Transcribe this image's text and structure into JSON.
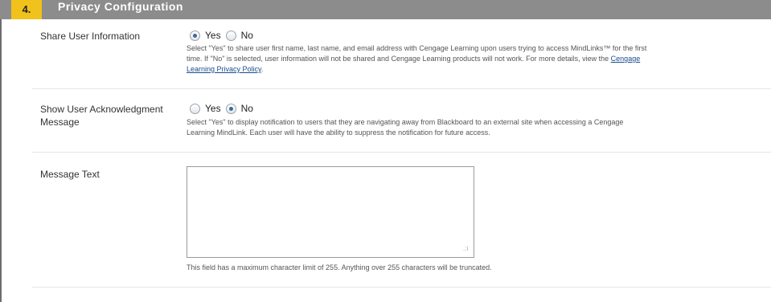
{
  "section": {
    "number": "4.",
    "title": "Privacy Configuration"
  },
  "share_user_info": {
    "label": "Share User Information",
    "options": [
      "Yes",
      "No"
    ],
    "selected": "Yes",
    "help_line1": "Select \"Yes\" to share user first name, last name, and email address with Cengage Learning upon users trying to access MindLinks™ for the first",
    "help_line2": "time. If \"No\" is selected, user information will not be shared and Cengage Learning products will not work. For more details, view the",
    "help_link_part1": "Cengage",
    "help_link_part2": "Learning Privacy Policy",
    "help_end": "."
  },
  "show_ack": {
    "label_line1": "Show User Acknowledgment",
    "label_line2": "Message",
    "options": [
      "Yes",
      "No"
    ],
    "selected": "No",
    "help_line1": "Select \"Yes\" to display notification to users that they are navigating away from Blackboard to an external site when accessing a Cengage",
    "help_line2": "Learning MindLink. Each user will have the ability to suppress the notification for future access."
  },
  "message_text": {
    "label": "Message Text",
    "value": "",
    "help": "This field has a maximum character limit of 255. Anything over 255 characters will be truncated."
  }
}
